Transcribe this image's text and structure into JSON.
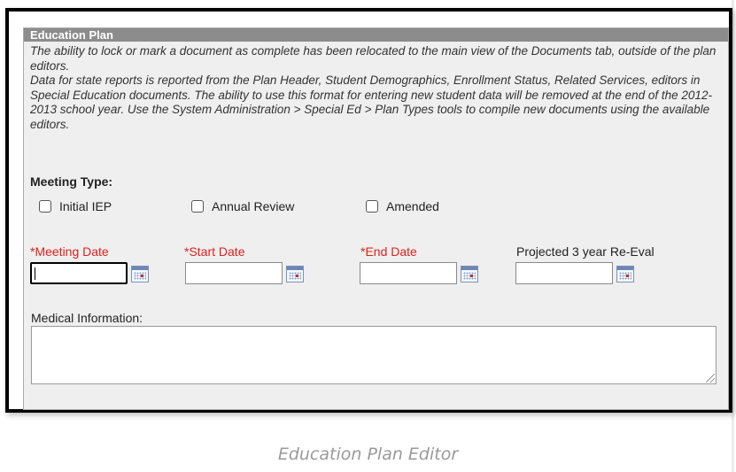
{
  "panel": {
    "title": "Education Plan",
    "note_1": "The ability to lock or mark a document as complete has been relocated to the main view of the Documents tab, outside of the plan editors.",
    "note_2": "Data for state reports is reported from the Plan Header, Student Demographics, Enrollment Status, Related Services, editors in Special Education documents. The ability to use this format for entering new student data will be removed at the end of the 2012-2013 school year. Use the System Administration > Special Ed > Plan Types tools to compile new documents using the available editors."
  },
  "meeting_type": {
    "label": "Meeting Type:",
    "options": [
      {
        "label": "Initial IEP",
        "checked": false
      },
      {
        "label": "Annual Review",
        "checked": false
      },
      {
        "label": "Amended",
        "checked": false
      }
    ]
  },
  "dates": {
    "meeting_date": {
      "label": "*Meeting Date",
      "value": "",
      "required": true
    },
    "start_date": {
      "label": "*Start Date",
      "value": "",
      "required": true
    },
    "end_date": {
      "label": "*End Date",
      "value": "",
      "required": true
    },
    "reeval_date": {
      "label": "Projected 3 year Re-Eval",
      "value": "",
      "required": false
    }
  },
  "medical": {
    "label": "Medical Information:",
    "value": ""
  },
  "caption": "Education Plan Editor",
  "colors": {
    "required_label": "#e0201c",
    "header_bg": "#8c8c8c",
    "panel_bg": "#efefef"
  }
}
